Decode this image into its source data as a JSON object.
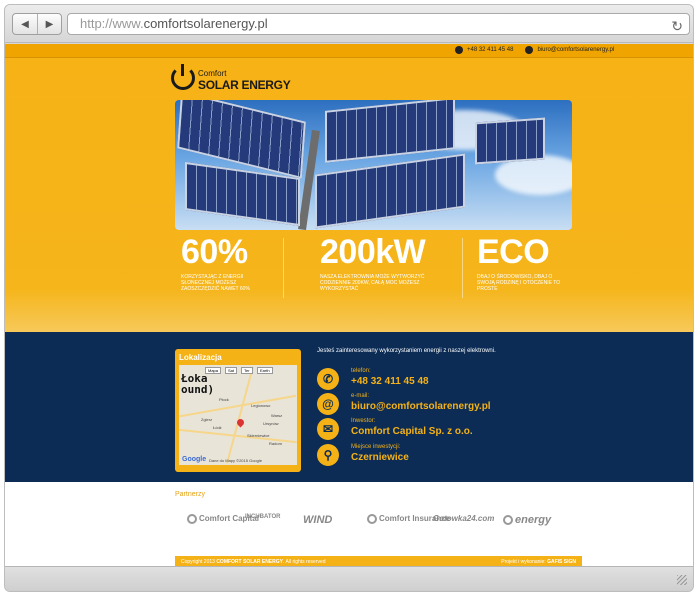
{
  "browser": {
    "url_prefix": "http://www.",
    "url_domain": "comfortsolarenergy.pl"
  },
  "header": {
    "phone": "+48 32 411 45 48",
    "email": "biuro@comfortsolarenergy.pl",
    "logo_small": "Comfort",
    "logo_big": "SOLAR ENERGY"
  },
  "stats": [
    {
      "big": "60%",
      "desc": "Korzystając z energii słonecznej możesz zaoszczędzić nawet 60%"
    },
    {
      "big": "200kW",
      "desc": "Nasza elektrownia może wytworzyć codziennie 200kW, całą moc możesz wykorzystać"
    },
    {
      "big": "ECO",
      "desc": "Dbaj o środowisko, dbaj o swoją rodzinę i otoczenie to proste"
    }
  ],
  "location": {
    "title": "Lokalizacja",
    "map_tabs": [
      "Mapa",
      "Sat",
      "Ter",
      "Earth"
    ],
    "overlay_text_1": "Łoka",
    "overlay_text_2": "ound)",
    "towns": [
      "Płock",
      "Legionowo",
      "Warsz",
      "Łódź",
      "Ursynów",
      "Zgierz",
      "Skierniewice",
      "Radom"
    ],
    "google": "Google",
    "map_credit": "Dane do Mapy ©2015 Google"
  },
  "contact": {
    "intro": "Jesteś zainteresowany wykorzystaniem energii z naszej elektrowni.",
    "rows": [
      {
        "icon": "phone-icon",
        "glyph": "✆",
        "label": "telefon:",
        "value": "+48 32 411 45 48"
      },
      {
        "icon": "at-icon",
        "glyph": "@",
        "label": "e-mail:",
        "value": "biuro@comfortsolarenergy.pl"
      },
      {
        "icon": "mail-icon",
        "glyph": "✉",
        "label": "Inwestor:",
        "value": "Comfort Capital Sp. z o.o."
      },
      {
        "icon": "location-pin-icon",
        "glyph": "⚲",
        "label": "Miejsce inwestycji:",
        "value": "Czerniewice"
      }
    ]
  },
  "partners": {
    "title": "Partnerzy",
    "items": [
      "Comfort Capital",
      "INCUBATOR",
      "WIND",
      "Comfort Insurance",
      "Gotowka24.com",
      "energy"
    ]
  },
  "footer": {
    "copyright_prefix": "Copyright 2013",
    "copyright_brand": "COMFORT SOLAR ENERGY",
    "copyright_suffix": "All rights reserved",
    "design_label": "Projekt i wykonanie:",
    "design_brand": "GAFIS SIGN"
  }
}
